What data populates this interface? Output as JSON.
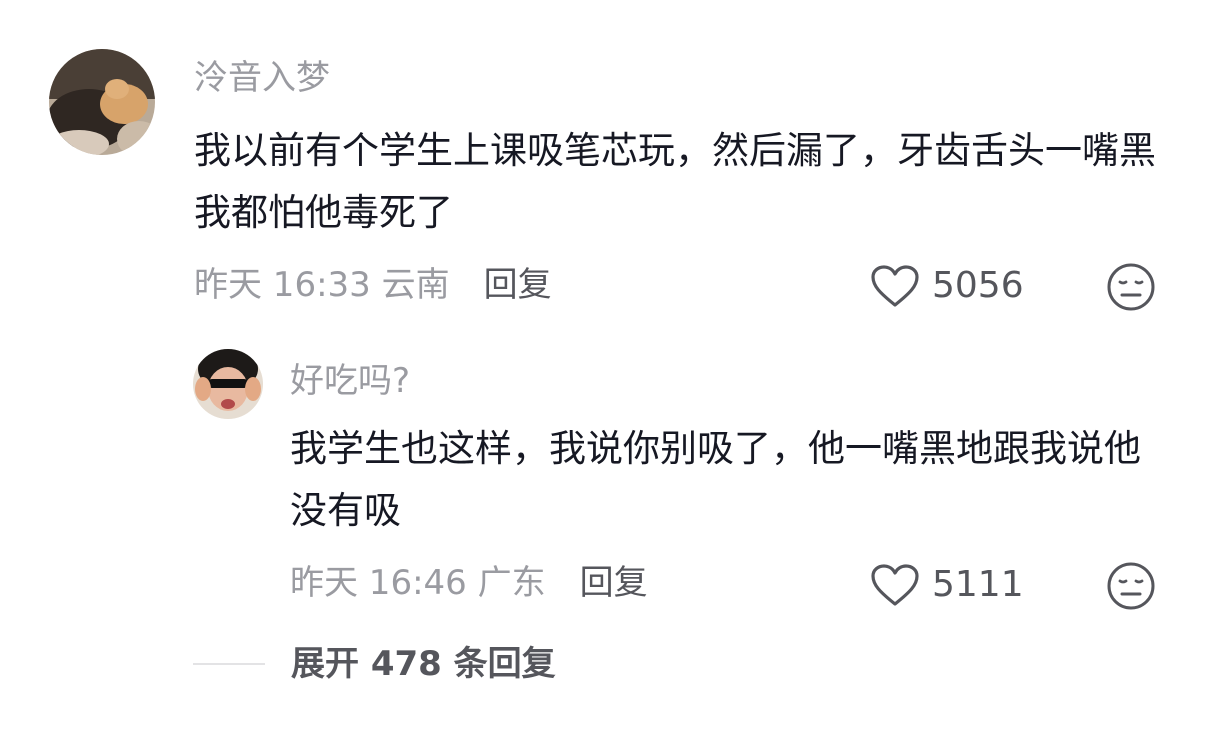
{
  "comments": [
    {
      "avatar_icon": "avatar-photo-cat",
      "username": "泠音入梦",
      "content": "我以前有个学生上课吸笔芯玩，然后漏了，牙齿舌头一嘴黑我都怕他毒死了",
      "time_location": "昨天 16:33 云南",
      "reply_label": "回复",
      "likes": "5056"
    }
  ],
  "replies": [
    {
      "avatar_icon": "avatar-photo-sunglasses",
      "username": "好吃吗?",
      "content": "我学生也这样，我说你别吸了，他一嘴黑地跟我说他没有吸",
      "time_location": "昨天 16:46 广东",
      "reply_label": "回复",
      "likes": "5111"
    }
  ],
  "expand": {
    "label": "展开 478 条回复"
  },
  "colors": {
    "primary_text": "#161823",
    "secondary_text": "#9a9ba1",
    "action_text": "#55565c"
  }
}
